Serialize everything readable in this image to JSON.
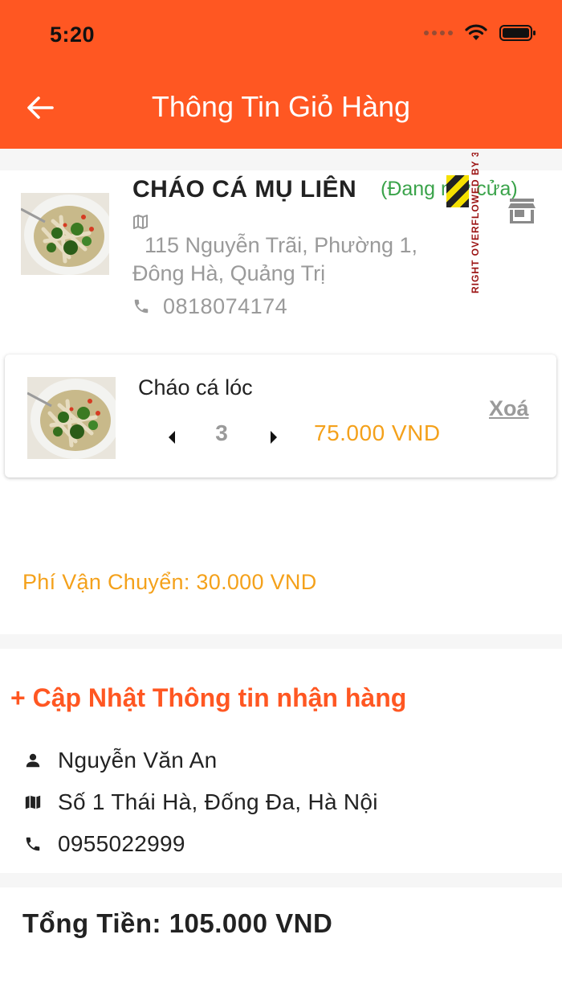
{
  "status_bar": {
    "time": "5:20"
  },
  "header": {
    "title": "Thông Tin Giỏ Hàng"
  },
  "shop": {
    "name": "CHÁO CÁ MỤ LIÊN",
    "status": "(Đang mở cửa)",
    "overflow_warning": "RIGHT OVERFLOWED BY 3",
    "address": "115 Nguyễn Trãi, Phường 1, Đông Hà, Quảng Trị",
    "phone": "0818074174"
  },
  "cart_item": {
    "name": "Cháo cá lóc",
    "quantity": "3",
    "price": "75.000 VND",
    "delete_label": "Xoá"
  },
  "shipping_fee": "Phí Vận Chuyển: 30.000 VND",
  "delivery": {
    "update_label": "+ Cập Nhật Thông tin nhận hàng",
    "name": "Nguyễn Văn An",
    "address": "Số 1 Thái Hà, Đống Đa, Hà Nội",
    "phone": "0955022999"
  },
  "total": "Tổng Tiền: 105.000 VND",
  "colors": {
    "primary": "#FF5722",
    "price": "#F4A11B",
    "open_status": "#3aa34a",
    "muted": "#9a9a9a"
  }
}
